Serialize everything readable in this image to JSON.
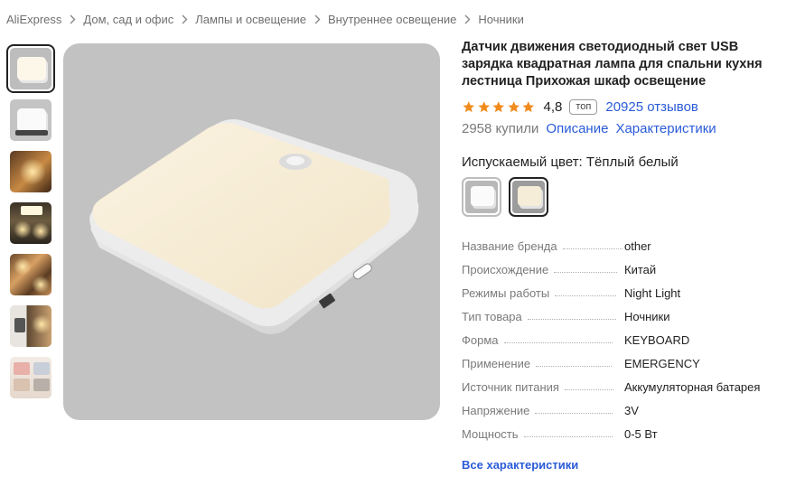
{
  "breadcrumb": [
    "AliExpress",
    "Дом, сад и офис",
    "Лампы и освещение",
    "Внутреннее освещение",
    "Ночники"
  ],
  "product": {
    "title": "Датчик движения светодиодный свет USB зарядка квадратная лампа для спальни кухня лестница Прихожая шкаф освещение",
    "rating": "4,8",
    "badge": "топ",
    "reviews": "20925 отзывов",
    "sold": "2958 купили",
    "tab_description": "Описание",
    "tab_specs": "Характеристики"
  },
  "color": {
    "label": "Испускаемый цвет: Тёплый белый",
    "swatches": [
      "cold-white",
      "warm-white"
    ],
    "selected": "warm-white"
  },
  "specs": [
    {
      "key": "Название бренда",
      "value": "other"
    },
    {
      "key": "Происхождение",
      "value": "Китай"
    },
    {
      "key": "Режимы работы",
      "value": "Night Light"
    },
    {
      "key": "Тип товара",
      "value": "Ночники"
    },
    {
      "key": "Форма",
      "value": "KEYBOARD"
    },
    {
      "key": "Применение",
      "value": "EMERGENCY"
    },
    {
      "key": "Источник питания",
      "value": "Аккумуляторная батарея"
    },
    {
      "key": "Напряжение",
      "value": "3V"
    },
    {
      "key": "Мощность",
      "value": "0-5 Вт"
    }
  ],
  "all_specs_link": "Все характеристики",
  "colors": {
    "link": "#2a5bd7",
    "star": "#f08b1d",
    "image_bg": "#c2c2c2"
  },
  "icons": {
    "breadcrumb_separator": "chevron-right-icon",
    "rating": "star-icon"
  }
}
